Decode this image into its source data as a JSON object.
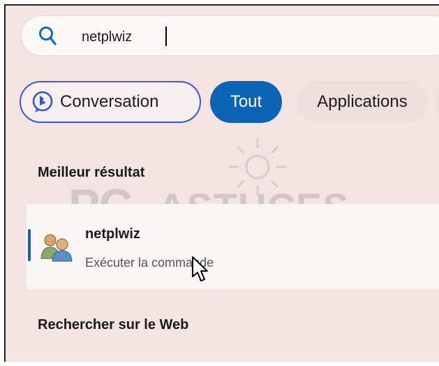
{
  "search": {
    "query": "netplwiz"
  },
  "filters": [
    {
      "label": "Conversation"
    },
    {
      "label": "Tout"
    },
    {
      "label": "Applications"
    }
  ],
  "best_match": {
    "heading": "Meilleur résultat",
    "name": "netplwiz",
    "subtitle": "Exécuter la commande"
  },
  "web": {
    "heading": "Rechercher sur le Web"
  },
  "watermark": {
    "part1": "PC",
    "part2": "ASTUCES"
  },
  "colors": {
    "accent": "#0c63b6",
    "conversation_border": "#3b56d2",
    "panel_background": "#f3e3e3"
  },
  "icons": {
    "search": "search-icon",
    "conversation": "bing-chat-icon",
    "app": "users-icon"
  }
}
